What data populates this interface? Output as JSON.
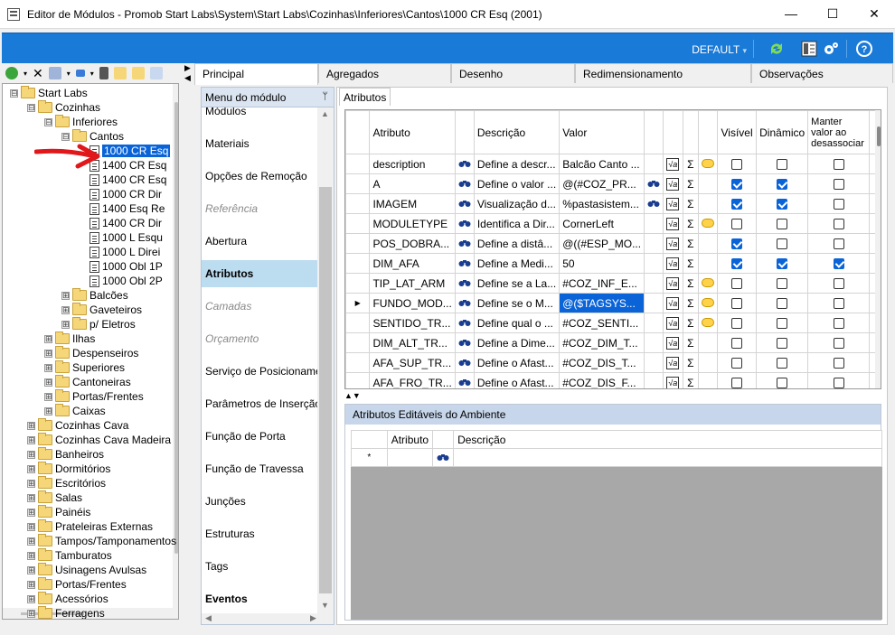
{
  "window": {
    "title": "Editor de Módulos - Promob Start Labs\\System\\Start Labs\\Cozinhas\\Inferiores\\Cantos\\1000 CR Esq (2001)",
    "minimize": "—",
    "maximize": "☐",
    "close": "✕"
  },
  "ribbon": {
    "profile": "DEFAULT",
    "profile_arrow": "▾",
    "accent_color": "#1a7ad8"
  },
  "tree": {
    "nodes": [
      {
        "label": "Start Labs",
        "depth": 0,
        "type": "folder",
        "expander": "⊟"
      },
      {
        "label": "Cozinhas",
        "depth": 1,
        "type": "folder",
        "expander": "⊟"
      },
      {
        "label": "Inferiores",
        "depth": 2,
        "type": "folder",
        "expander": "⊟"
      },
      {
        "label": "Cantos",
        "depth": 3,
        "type": "folder",
        "expander": "⊟"
      },
      {
        "label": "1000 CR Esq",
        "depth": 4,
        "type": "doc",
        "selected": true
      },
      {
        "label": "1400 CR Esq",
        "depth": 4,
        "type": "doc"
      },
      {
        "label": "1400 CR Esq",
        "depth": 4,
        "type": "doc"
      },
      {
        "label": "1000 CR Dir",
        "depth": 4,
        "type": "doc"
      },
      {
        "label": "1400 Esq Re",
        "depth": 4,
        "type": "doc"
      },
      {
        "label": "1400 CR Dir",
        "depth": 4,
        "type": "doc"
      },
      {
        "label": "1000 L Esqu",
        "depth": 4,
        "type": "doc"
      },
      {
        "label": "1000 L Direi",
        "depth": 4,
        "type": "doc"
      },
      {
        "label": "1000 Obl 1P",
        "depth": 4,
        "type": "doc"
      },
      {
        "label": "1000 Obl 2P",
        "depth": 4,
        "type": "doc"
      },
      {
        "label": "Balcões",
        "depth": 3,
        "type": "folder",
        "expander": "⊞"
      },
      {
        "label": "Gaveteiros",
        "depth": 3,
        "type": "folder",
        "expander": "⊞"
      },
      {
        "label": "p/ Eletros",
        "depth": 3,
        "type": "folder",
        "expander": "⊞"
      },
      {
        "label": "Ilhas",
        "depth": 2,
        "type": "folder",
        "expander": "⊞"
      },
      {
        "label": "Despenseiros",
        "depth": 2,
        "type": "folder",
        "expander": "⊞"
      },
      {
        "label": "Superiores",
        "depth": 2,
        "type": "folder",
        "expander": "⊞"
      },
      {
        "label": "Cantoneiras",
        "depth": 2,
        "type": "folder",
        "expander": "⊞"
      },
      {
        "label": "Portas/Frentes",
        "depth": 2,
        "type": "folder",
        "expander": "⊞"
      },
      {
        "label": "Caixas",
        "depth": 2,
        "type": "folder",
        "expander": "⊞"
      },
      {
        "label": "Cozinhas Cava",
        "depth": 1,
        "type": "folder",
        "expander": "⊞"
      },
      {
        "label": "Cozinhas Cava Madeira",
        "depth": 1,
        "type": "folder",
        "expander": "⊞"
      },
      {
        "label": "Banheiros",
        "depth": 1,
        "type": "folder",
        "expander": "⊞"
      },
      {
        "label": "Dormitórios",
        "depth": 1,
        "type": "folder",
        "expander": "⊞"
      },
      {
        "label": "Escritórios",
        "depth": 1,
        "type": "folder",
        "expander": "⊞"
      },
      {
        "label": "Salas",
        "depth": 1,
        "type": "folder",
        "expander": "⊞"
      },
      {
        "label": "Painéis",
        "depth": 1,
        "type": "folder",
        "expander": "⊞"
      },
      {
        "label": "Prateleiras Externas",
        "depth": 1,
        "type": "folder",
        "expander": "⊞"
      },
      {
        "label": "Tampos/Tamponamentos",
        "depth": 1,
        "type": "folder",
        "expander": "⊞"
      },
      {
        "label": "Tamburatos",
        "depth": 1,
        "type": "folder",
        "expander": "⊞"
      },
      {
        "label": "Usinagens Avulsas",
        "depth": 1,
        "type": "folder",
        "expander": "⊞"
      },
      {
        "label": "Portas/Frentes",
        "depth": 1,
        "type": "folder",
        "expander": "⊞"
      },
      {
        "label": "Acessórios",
        "depth": 1,
        "type": "folder",
        "expander": "⊞"
      },
      {
        "label": "Ferragens",
        "depth": 1,
        "type": "folder",
        "expander": "⊞"
      }
    ]
  },
  "tabs": [
    {
      "label": "Principal",
      "active": true
    },
    {
      "label": "Agregados"
    },
    {
      "label": "Desenho"
    },
    {
      "label": "Redimensionamento"
    },
    {
      "label": "Observações"
    }
  ],
  "menu": {
    "header": "Menu do módulo",
    "pin": "ᛘ",
    "items": [
      {
        "label": "Módulos",
        "style": "normal"
      },
      {
        "label": "Materiais",
        "style": "normal"
      },
      {
        "label": "Opções de Remoção",
        "style": "normal"
      },
      {
        "label": "Referência",
        "style": "disabled"
      },
      {
        "label": "Abertura",
        "style": "normal"
      },
      {
        "label": "Atributos",
        "style": "selected"
      },
      {
        "label": "Camadas",
        "style": "disabled"
      },
      {
        "label": "Orçamento",
        "style": "disabled"
      },
      {
        "label": "Serviço de Posicionamento",
        "style": "normal"
      },
      {
        "label": "Parâmetros de Inserção",
        "style": "normal"
      },
      {
        "label": "Função de Porta",
        "style": "normal"
      },
      {
        "label": "Função de Travessa",
        "style": "normal"
      },
      {
        "label": "Junções",
        "style": "normal"
      },
      {
        "label": "Estruturas",
        "style": "normal"
      },
      {
        "label": "Tags",
        "style": "normal"
      },
      {
        "label": "Eventos",
        "style": "bold"
      }
    ]
  },
  "attributes": {
    "subtab": "Atributos",
    "columns": {
      "attribute": "Atributo",
      "description": "Descrição",
      "value": "Valor",
      "visible": "Visível",
      "dynamic": "Dinâmico",
      "keep": "Manter valor ao desassociar"
    },
    "rows": [
      {
        "attr": "description",
        "desc": "Define a descr...",
        "value": "Balcão Canto ...",
        "val_icon": false,
        "bubble": true,
        "visible": false,
        "dynamic": false,
        "keep": false
      },
      {
        "attr": "A",
        "desc": "Define o valor ...",
        "value": "@(#COZ_PR...",
        "val_icon": true,
        "bubble": false,
        "visible": true,
        "dynamic": true,
        "keep": false
      },
      {
        "attr": "IMAGEM",
        "desc": "Visualização d...",
        "value": "%pastasistem...",
        "val_icon": true,
        "bubble": false,
        "visible": true,
        "dynamic": true,
        "keep": false
      },
      {
        "attr": "MODULETYPE",
        "desc": "Identifica a Dir...",
        "value": "CornerLeft",
        "val_icon": false,
        "bubble": true,
        "visible": false,
        "dynamic": false,
        "keep": false
      },
      {
        "attr": "POS_DOBRA...",
        "desc": "Define a distâ...",
        "value": "@((#ESP_MO...",
        "val_icon": false,
        "bubble": false,
        "visible": true,
        "dynamic": false,
        "keep": false
      },
      {
        "attr": "DIM_AFA",
        "desc": "Define a Medi...",
        "value": "50",
        "val_icon": false,
        "bubble": false,
        "visible": true,
        "dynamic": true,
        "keep": true
      },
      {
        "attr": "TIP_LAT_ARM",
        "desc": "Define se a La...",
        "value": "#COZ_INF_E...",
        "val_icon": false,
        "bubble": true,
        "visible": false,
        "dynamic": false,
        "keep": false
      },
      {
        "attr": "FUNDO_MOD...",
        "desc": "Define se o M...",
        "value": "@($TAGSYS...",
        "val_icon": false,
        "bubble": true,
        "visible": false,
        "dynamic": false,
        "keep": false,
        "current": true
      },
      {
        "attr": "SENTIDO_TR...",
        "desc": "Define qual o ...",
        "value": "#COZ_SENTI...",
        "val_icon": false,
        "bubble": true,
        "visible": false,
        "dynamic": false,
        "keep": false
      },
      {
        "attr": "DIM_ALT_TR...",
        "desc": "Define a Dime...",
        "value": "#COZ_DIM_T...",
        "val_icon": false,
        "bubble": false,
        "visible": false,
        "dynamic": false,
        "keep": false
      },
      {
        "attr": "AFA_SUP_TR...",
        "desc": "Define o Afast...",
        "value": "#COZ_DIS_T...",
        "val_icon": false,
        "bubble": false,
        "visible": false,
        "dynamic": false,
        "keep": false
      },
      {
        "attr": "AFA_FRO_TR...",
        "desc": "Define o Afast...",
        "value": "#COZ_DIS_F...",
        "val_icon": false,
        "bubble": false,
        "visible": false,
        "dynamic": false,
        "keep": false
      }
    ],
    "icons": {
      "binoculars": "👁",
      "formula": "√a",
      "sigma": "Σ",
      "row_pointer": "▶"
    }
  },
  "ambient": {
    "header": "Atributos Editáveis do Ambiente",
    "col_attribute": "Atributo",
    "col_description": "Descrição",
    "new_row_marker": "*"
  },
  "misc": {
    "split_up": "▲",
    "split_down": "▼",
    "expand_left": "◀",
    "expand_right": "▶"
  }
}
